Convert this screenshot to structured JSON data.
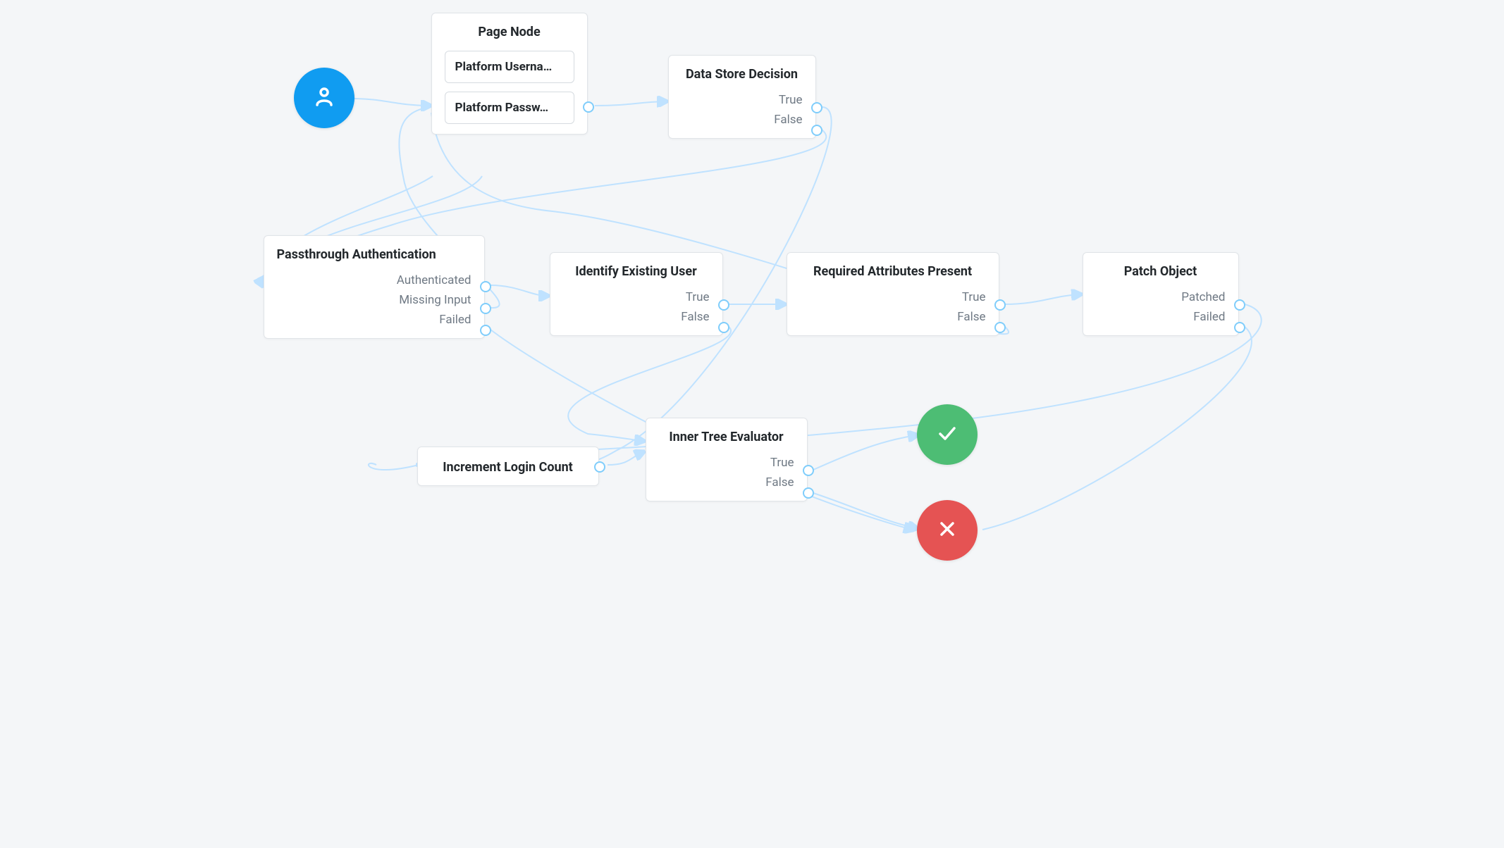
{
  "nodes": {
    "page_node": {
      "title": "Page Node",
      "items": [
        "Platform Userna…",
        "Platform Passw…"
      ]
    },
    "data_store_decision": {
      "title": "Data Store Decision",
      "outcomes": [
        "True",
        "False"
      ]
    },
    "passthrough_auth": {
      "title": "Passthrough Authentication",
      "outcomes": [
        "Authenticated",
        "Missing Input",
        "Failed"
      ]
    },
    "identify_user": {
      "title": "Identify Existing User",
      "outcomes": [
        "True",
        "False"
      ]
    },
    "required_attrs": {
      "title": "Required Attributes Present",
      "outcomes": [
        "True",
        "False"
      ]
    },
    "patch_object": {
      "title": "Patch Object",
      "outcomes": [
        "Patched",
        "Failed"
      ]
    },
    "increment_login": {
      "title": "Increment Login Count"
    },
    "inner_tree": {
      "title": "Inner Tree Evaluator",
      "outcomes": [
        "True",
        "False"
      ]
    }
  }
}
